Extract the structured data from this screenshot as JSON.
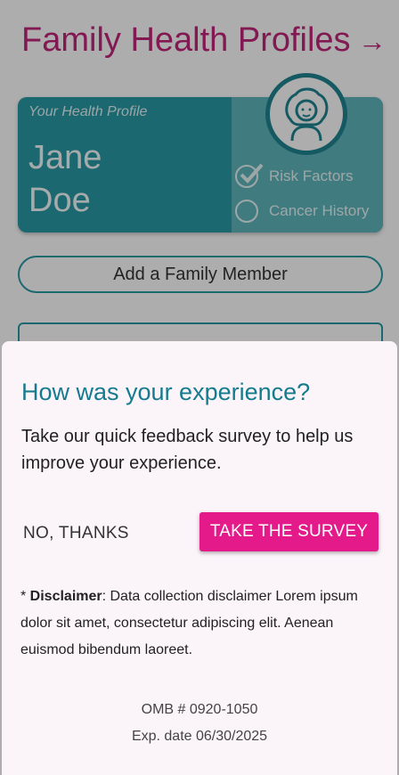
{
  "page": {
    "title": "Family Health Profiles",
    "title_arrow": "→",
    "profile_card": {
      "caption": "Your Health Profile",
      "first_name": "Jane",
      "last_name": "Doe",
      "checks": [
        {
          "label": "Risk Factors",
          "checked": true
        },
        {
          "label": "Cancer History",
          "checked": false
        }
      ]
    },
    "add_member_label": "Add a Family Member"
  },
  "survey": {
    "title": "How was your experience?",
    "body": "Take our quick feedback survey to help us improve your experience.",
    "no_thanks_label": "NO, THANKS",
    "take_survey_label": "TAKE THE SURVEY",
    "disclaimer_prefix": "* ",
    "disclaimer_heading": "Disclaimer",
    "disclaimer_text": ": Data collection disclaimer Lorem ipsum dolor sit amet, consectetur adipiscing elit. Aenean euismod bibendum laoreet.",
    "omb_number": "OMB # 0920-1050",
    "exp_date": "Exp. date 06/30/2025"
  },
  "colors": {
    "brand_pink": "#e4198a",
    "title_pink": "#c0267a",
    "teal": "#2a9aa5",
    "heading_teal": "#157b8f"
  }
}
